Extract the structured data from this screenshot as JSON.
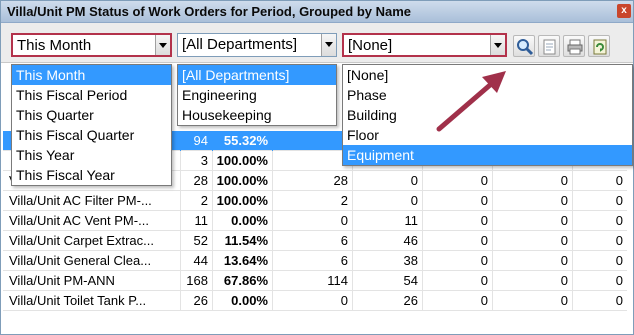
{
  "window": {
    "title": "Villa/Unit PM Status of Work Orders for Period, Grouped by Name",
    "close_label": "x"
  },
  "filters": {
    "period": {
      "value": "This Month",
      "options": [
        "This Month",
        "This Fiscal Period",
        "This Quarter",
        "This Fiscal Quarter",
        "This Year",
        "This Fiscal Year"
      ],
      "highlighted": "This Month"
    },
    "department": {
      "value": "[All Departments]",
      "options": [
        "[All Departments]",
        "Engineering",
        "Housekeeping"
      ],
      "highlighted": "[All Departments]"
    },
    "grouping": {
      "value": "[None]",
      "options": [
        "[None]",
        "Phase",
        "Building",
        "Floor",
        "Equipment"
      ],
      "highlighted": "Equipment"
    }
  },
  "toolbar": {
    "icons": [
      "search-icon",
      "export-icon",
      "print-icon",
      "refresh-icon"
    ]
  },
  "rows": [
    {
      "name": "",
      "count": "94",
      "pct": "55.32%",
      "a": "",
      "b": "",
      "c": "",
      "d": "",
      "e": "",
      "selected": true
    },
    {
      "name": "",
      "count": "3",
      "pct": "100.00%",
      "a": "",
      "b": "",
      "c": "",
      "d": "",
      "e": ""
    },
    {
      "name": "Villa Care General Clea...",
      "count": "28",
      "pct": "100.00%",
      "a": "28",
      "b": "0",
      "c": "0",
      "d": "0",
      "e": "0"
    },
    {
      "name": "Villa/Unit AC Filter PM-...",
      "count": "2",
      "pct": "100.00%",
      "a": "2",
      "b": "0",
      "c": "0",
      "d": "0",
      "e": "0"
    },
    {
      "name": "Villa/Unit AC Vent PM-...",
      "count": "11",
      "pct": "0.00%",
      "a": "0",
      "b": "11",
      "c": "0",
      "d": "0",
      "e": "0"
    },
    {
      "name": "Villa/Unit Carpet Extrac...",
      "count": "52",
      "pct": "11.54%",
      "a": "6",
      "b": "46",
      "c": "0",
      "d": "0",
      "e": "0"
    },
    {
      "name": "Villa/Unit General Clea...",
      "count": "44",
      "pct": "13.64%",
      "a": "6",
      "b": "38",
      "c": "0",
      "d": "0",
      "e": "0"
    },
    {
      "name": "Villa/Unit PM-ANN",
      "count": "168",
      "pct": "67.86%",
      "a": "114",
      "b": "54",
      "c": "0",
      "d": "0",
      "e": "0"
    },
    {
      "name": "Villa/Unit Toilet Tank P...",
      "count": "26",
      "pct": "0.00%",
      "a": "0",
      "b": "26",
      "c": "0",
      "d": "0",
      "e": "0"
    }
  ],
  "colors": {
    "highlight": "#3399ff",
    "annotation": "#a0304a"
  }
}
